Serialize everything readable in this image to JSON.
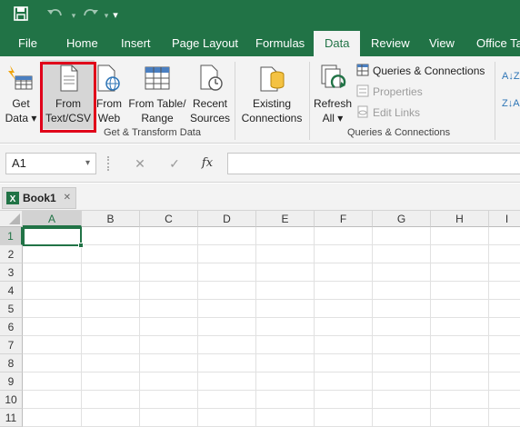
{
  "qat": {
    "save_icon": "save-icon",
    "undo_icon": "undo-icon",
    "redo_icon": "redo-icon",
    "customize_glyph": "▾"
  },
  "tabs": [
    {
      "label": "File"
    },
    {
      "label": "Home"
    },
    {
      "label": "Insert"
    },
    {
      "label": "Page Layout"
    },
    {
      "label": "Formulas"
    },
    {
      "label": "Data",
      "active": true
    },
    {
      "label": "Review"
    },
    {
      "label": "View"
    },
    {
      "label": "Office Tab"
    }
  ],
  "ribbon": {
    "get_data": {
      "line1": "Get",
      "line2": "Data ▾"
    },
    "from_text": {
      "line1": "From",
      "line2": "Text/CSV"
    },
    "from_web": {
      "line1": "From",
      "line2": "Web"
    },
    "from_table": {
      "line1": "From Table/",
      "line2": "Range"
    },
    "recent_sources": {
      "line1": "Recent",
      "line2": "Sources"
    },
    "existing_connections": {
      "line1": "Existing",
      "line2": "Connections"
    },
    "group1_label": "Get & Transform Data",
    "refresh_all": {
      "line1": "Refresh",
      "line2": "All ▾"
    },
    "queries_connections": "Queries & Connections",
    "properties": "Properties",
    "edit_links": "Edit Links",
    "group2_label": "Queries & Connections",
    "sort_az": "A↓Z",
    "sort_za": "Z↓A"
  },
  "formula_bar": {
    "name_box": "A1",
    "name_box_dropdown": "▾",
    "cancel_glyph": "✕",
    "enter_glyph": "✓",
    "fx": "fx",
    "formula_value": ""
  },
  "workbook": {
    "tab_label": "Book1",
    "close_glyph": "✕"
  },
  "sheet": {
    "columns": [
      "A",
      "B",
      "C",
      "D",
      "E",
      "F",
      "G",
      "H",
      "I"
    ],
    "rows": [
      "1",
      "2",
      "3",
      "4",
      "5",
      "6",
      "7",
      "8",
      "9",
      "10",
      "11"
    ],
    "active_cell": "A1"
  },
  "colors": {
    "accent": "#217346",
    "highlight": "#e0001a"
  }
}
